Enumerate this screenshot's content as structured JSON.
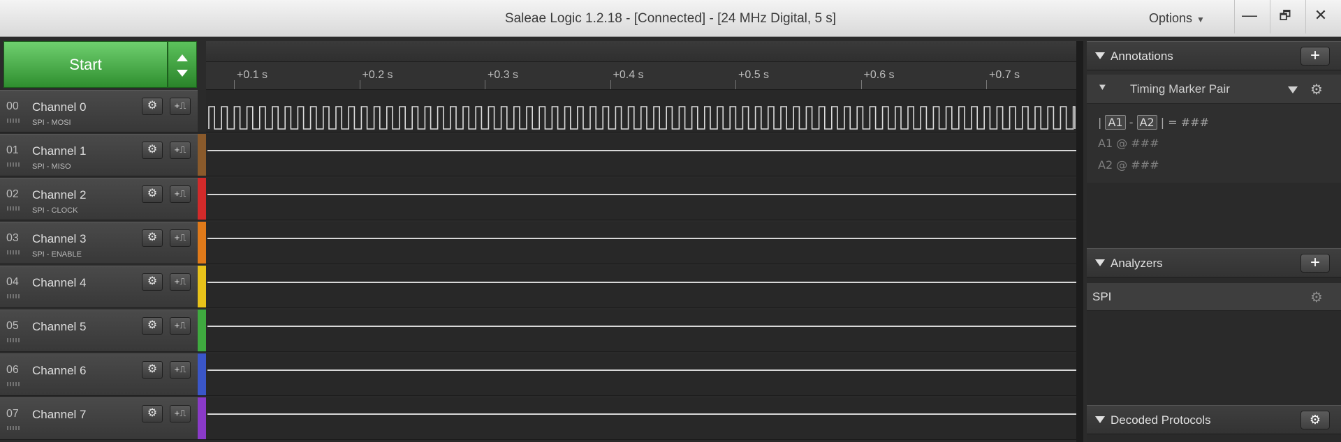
{
  "window": {
    "title": "Saleae Logic 1.2.18 - [Connected] - [24 MHz Digital, 5 s]",
    "options_label": "Options",
    "minimize_glyph": "—",
    "restore_glyph": "🗗",
    "close_glyph": "✕"
  },
  "capture": {
    "start_label": "Start"
  },
  "channels": [
    {
      "num": "00",
      "name": "Channel 0",
      "sub": "SPI - MOSI",
      "color": "#2a2a2a"
    },
    {
      "num": "01",
      "name": "Channel 1",
      "sub": "SPI - MISO",
      "color": "#8a5a2b"
    },
    {
      "num": "02",
      "name": "Channel 2",
      "sub": "SPI - CLOCK",
      "color": "#d22a2a"
    },
    {
      "num": "03",
      "name": "Channel 3",
      "sub": "SPI - ENABLE",
      "color": "#e07a1a"
    },
    {
      "num": "04",
      "name": "Channel 4",
      "sub": "",
      "color": "#e8c21a"
    },
    {
      "num": "05",
      "name": "Channel 5",
      "sub": "",
      "color": "#3faa3f"
    },
    {
      "num": "06",
      "name": "Channel 6",
      "sub": "",
      "color": "#3a56c8"
    },
    {
      "num": "07",
      "name": "Channel 7",
      "sub": "",
      "color": "#8a3ac8"
    }
  ],
  "channel_buttons": {
    "gear_glyph": "⚙",
    "trigger_glyph": "+⎍"
  },
  "timeline": {
    "ticks": [
      "+0.1 s",
      "+0.2 s",
      "+0.3 s",
      "+0.4 s",
      "+0.5 s",
      "+0.6 s",
      "+0.7 s"
    ]
  },
  "annotations": {
    "header": "Annotations",
    "add_glyph": "+",
    "marker_pin_glyph": "⯆",
    "marker_label": "Timing Marker Pair",
    "gear_glyph": "⚙",
    "diff_prefix": "|",
    "a1": "A1",
    "dash": "-",
    "a2": "A2",
    "diff_suffix": "| = ###",
    "a1_line": "A1  @  ###",
    "a2_line": "A2  @  ###"
  },
  "analyzers": {
    "header": "Analyzers",
    "add_glyph": "+",
    "items": [
      {
        "name": "SPI"
      }
    ],
    "gear_glyph": "⚙"
  },
  "decoded_protocols": {
    "header": "Decoded Protocols",
    "gear_glyph": "⚙"
  }
}
